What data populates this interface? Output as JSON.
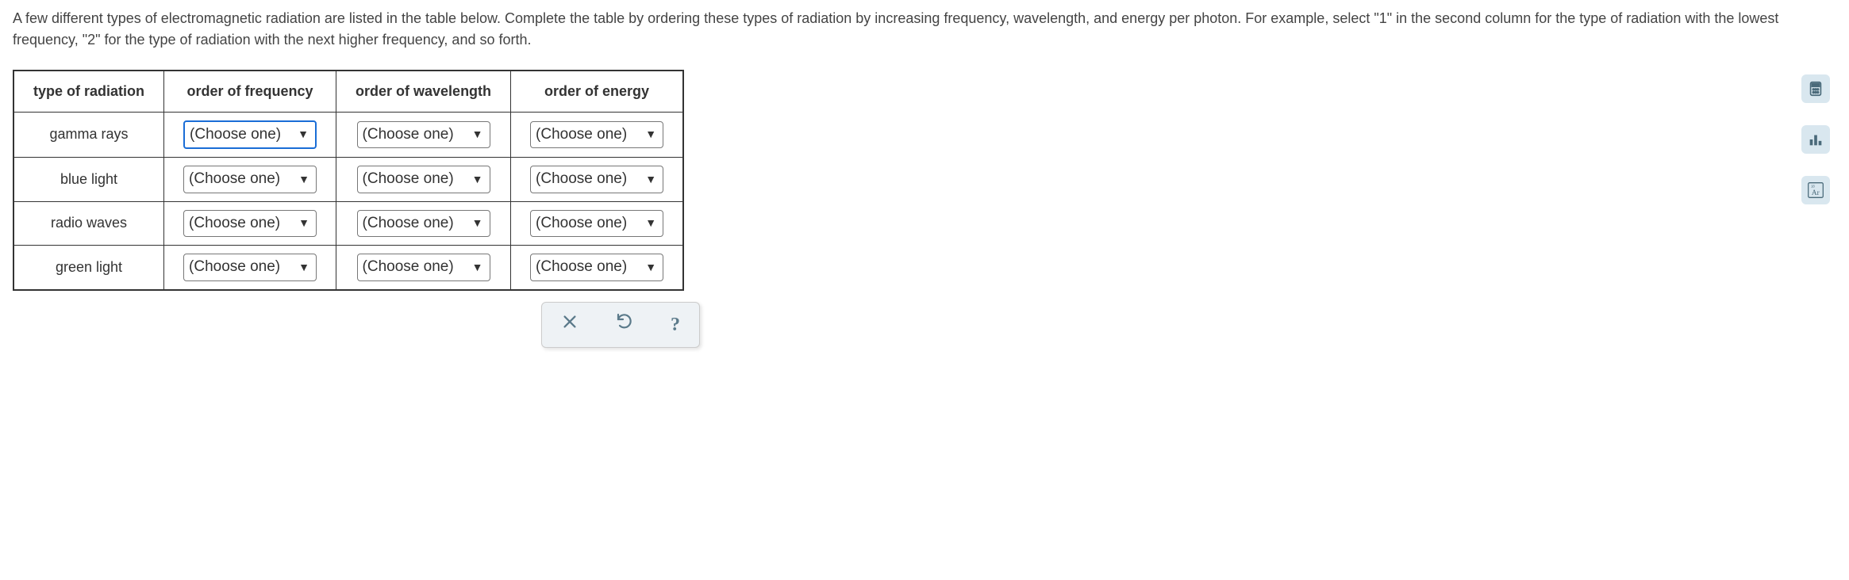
{
  "question": "A few different types of electromagnetic radiation are listed in the table below. Complete the table by ordering these types of radiation by increasing frequency, wavelength, and energy per photon. For example, select \"1\" in the second column for the type of radiation with the lowest frequency, \"2\" for the type of radiation with the next higher frequency, and so forth.",
  "headers": {
    "type": "type of radiation",
    "frequency": "order of frequency",
    "wavelength": "order of wavelength",
    "energy": "order of energy"
  },
  "rows": [
    {
      "type": "gamma rays"
    },
    {
      "type": "blue light"
    },
    {
      "type": "radio waves"
    },
    {
      "type": "green light"
    }
  ],
  "dropdown_placeholder": "(Choose one)",
  "toolbar": {
    "close": "×",
    "reset": "↺",
    "help": "?"
  },
  "sidetools": {
    "calculator": "calculator",
    "chart": "chart",
    "periodic": "Ar"
  }
}
